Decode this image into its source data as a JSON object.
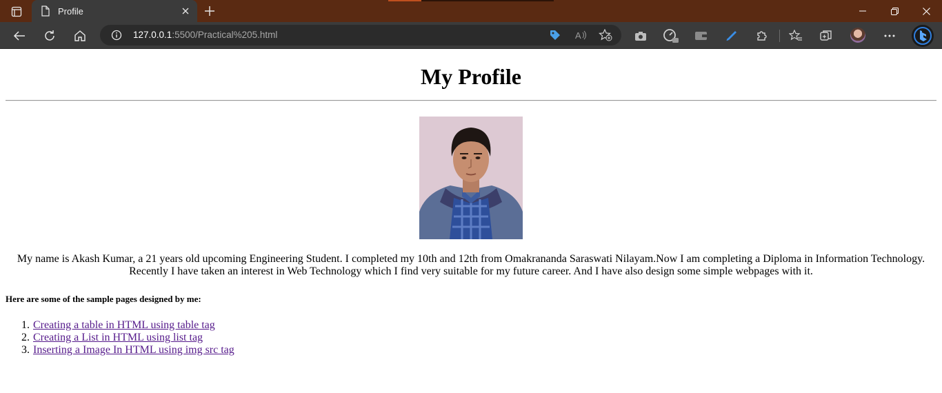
{
  "browser": {
    "tab_title": "Profile",
    "url_host": "127.0.0.1",
    "url_path": ":5500/Practical%205.html",
    "icons": [
      "tab-actions-icon",
      "page-icon",
      "close-icon",
      "plus-icon",
      "minimize-icon",
      "restore-icon",
      "close-window-icon",
      "back-icon",
      "refresh-icon",
      "home-icon",
      "info-icon",
      "tag-icon",
      "read-aloud-icon",
      "add-favorite-icon",
      "camera-icon",
      "browser-essentials-icon",
      "wallet-icon",
      "pen-icon",
      "extensions-icon",
      "favorites-icon",
      "collections-icon",
      "profile-avatar",
      "more-icon",
      "bing-icon"
    ],
    "colors": {
      "titlebar": "#5a2a12",
      "toolbar": "#3b3b3b",
      "link": "#551a8b"
    }
  },
  "page": {
    "title": "My Profile",
    "intro_line1": "My name is Akash Kumar, a 21 years old upcoming Engineering Student. I completed my 10th and 12th from Omakrananda Saraswati Nilayam.Now I am completing a Diploma in Information Technology.",
    "intro_line2": "Recently I have taken an interest in Web Technology which I find very suitable for my future career. And I have also design some simple webpages with it.",
    "subheading": "Here are some of the sample pages designed by me:",
    "links": [
      {
        "num": "1.",
        "label": "Creating a table in HTML using table tag"
      },
      {
        "num": "2.",
        "label": "Creating a List in HTML using list tag"
      },
      {
        "num": "3.",
        "label": "Inserting a Image In HTML using img src tag"
      }
    ]
  }
}
